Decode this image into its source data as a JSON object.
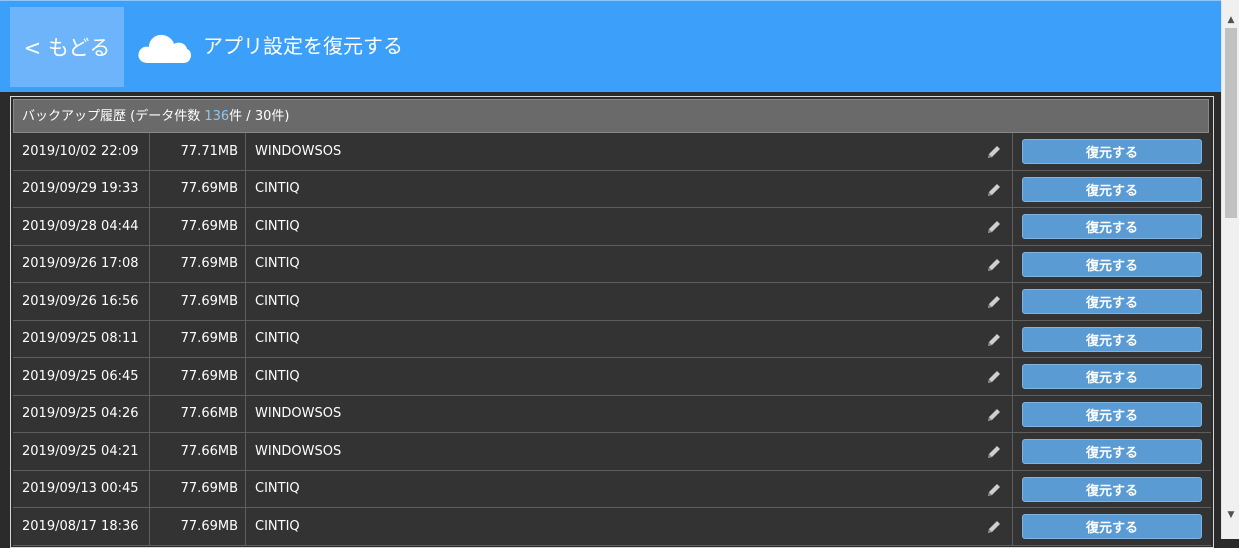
{
  "header": {
    "back_label": "< もどる",
    "title": "アプリ設定を復元する",
    "icon": "cloud-icon"
  },
  "panel": {
    "heading_prefix": "バックアップ履歴 (データ件数 ",
    "count": "136",
    "heading_suffix": "件 / 30件)"
  },
  "colors": {
    "header_bg": "#3c9ff9",
    "back_bg": "#6db4fa",
    "restore_button": "#5b9bd3",
    "count_text": "#8ec6ee"
  },
  "rows": [
    {
      "date": "2019/10/02 22:09",
      "size": "77.71MB",
      "name": "WINDOWSOS",
      "action": "復元する"
    },
    {
      "date": "2019/09/29 19:33",
      "size": "77.69MB",
      "name": "CINTIQ",
      "action": "復元する"
    },
    {
      "date": "2019/09/28 04:44",
      "size": "77.69MB",
      "name": "CINTIQ",
      "action": "復元する"
    },
    {
      "date": "2019/09/26 17:08",
      "size": "77.69MB",
      "name": "CINTIQ",
      "action": "復元する"
    },
    {
      "date": "2019/09/26 16:56",
      "size": "77.69MB",
      "name": "CINTIQ",
      "action": "復元する"
    },
    {
      "date": "2019/09/25 08:11",
      "size": "77.69MB",
      "name": "CINTIQ",
      "action": "復元する"
    },
    {
      "date": "2019/09/25 06:45",
      "size": "77.69MB",
      "name": "CINTIQ",
      "action": "復元する"
    },
    {
      "date": "2019/09/25 04:26",
      "size": "77.66MB",
      "name": "WINDOWSOS",
      "action": "復元する"
    },
    {
      "date": "2019/09/25 04:21",
      "size": "77.66MB",
      "name": "WINDOWSOS",
      "action": "復元する"
    },
    {
      "date": "2019/09/13 00:45",
      "size": "77.69MB",
      "name": "CINTIQ",
      "action": "復元する"
    },
    {
      "date": "2019/08/17 18:36",
      "size": "77.69MB",
      "name": "CINTIQ",
      "action": "復元する"
    }
  ]
}
